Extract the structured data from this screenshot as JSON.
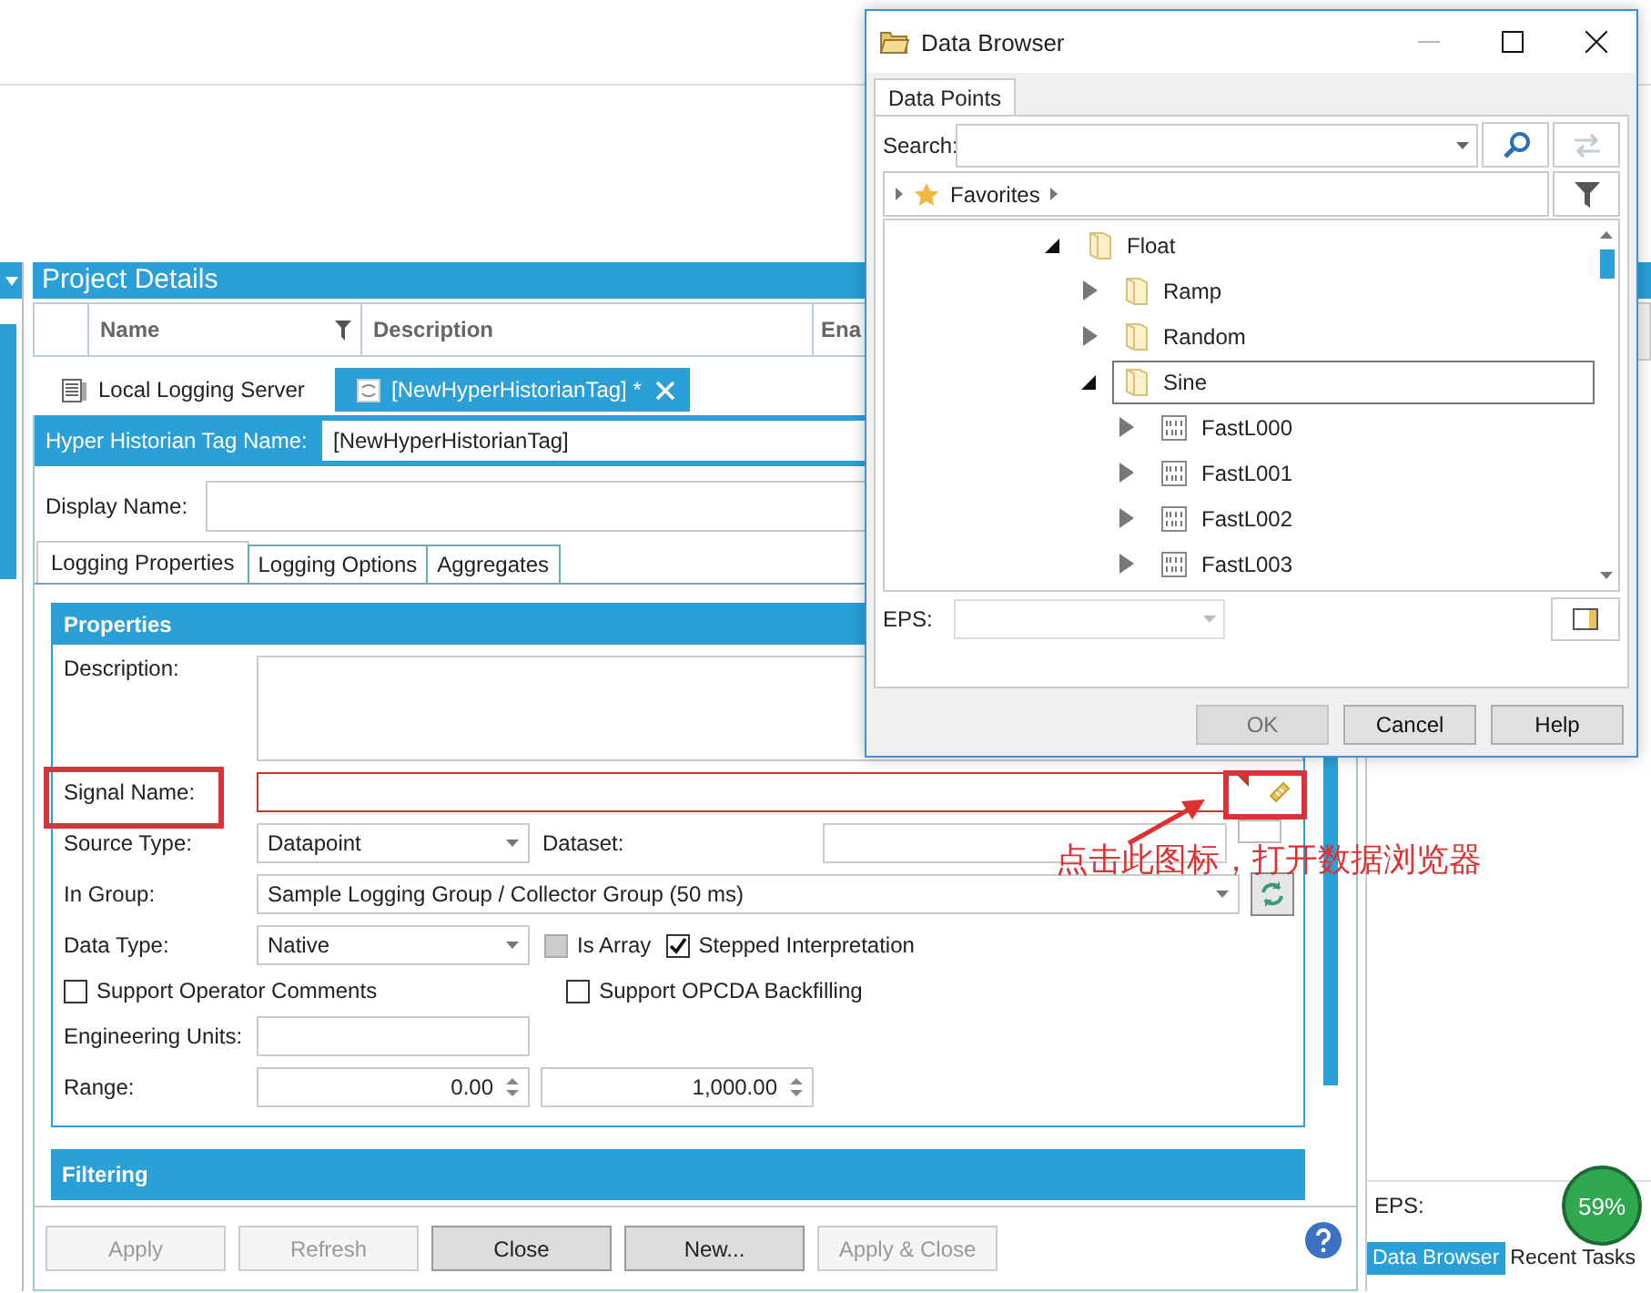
{
  "project_details": {
    "title": "Project Details",
    "columns": [
      {
        "label": "Name",
        "filter": true
      },
      {
        "label": "Description",
        "filter": false
      },
      {
        "label": "Ena",
        "filter": false
      }
    ]
  },
  "document_tabs": [
    {
      "label": "Local Logging Server",
      "kind": "server",
      "selected": false
    },
    {
      "label": "[NewHyperHistorianTag] *",
      "kind": "tag",
      "selected": true
    }
  ],
  "tag_name": {
    "label": "Hyper Historian Tag Name:",
    "value": "[NewHyperHistorianTag]"
  },
  "display_name": {
    "label": "Display Name:"
  },
  "property_tabs": [
    {
      "label": "Logging Properties",
      "selected": true
    },
    {
      "label": "Logging Options",
      "selected": false
    },
    {
      "label": "Aggregates",
      "selected": false
    }
  ],
  "properties": {
    "title": "Properties",
    "description_label": "Description:",
    "signal_name": {
      "label": "Signal Name:",
      "error": true
    },
    "source_type": {
      "label": "Source Type:",
      "value": "Datapoint"
    },
    "dataset": {
      "label": "Dataset:"
    },
    "in_group": {
      "label": "In Group:",
      "value": "Sample Logging Group / Collector Group (50 ms)"
    },
    "data_type": {
      "label": "Data Type:",
      "value": "Native"
    },
    "checkboxes": [
      {
        "label": "Is Array",
        "checked": false,
        "disabled": true
      },
      {
        "label": "Stepped Interpretation",
        "checked": true,
        "disabled": false
      },
      {
        "label": "Support Operator Comments",
        "checked": false,
        "disabled": false
      },
      {
        "label": "Support OPCDA Backfilling",
        "checked": false,
        "disabled": false
      }
    ],
    "engineering_units": {
      "label": "Engineering Units:"
    },
    "range": {
      "label": "Range:",
      "low": "0.00",
      "high": "1,000.00"
    }
  },
  "filtering": {
    "title": "Filtering"
  },
  "buttons": [
    {
      "label": "Apply",
      "disabled": true
    },
    {
      "label": "Refresh",
      "disabled": true
    },
    {
      "label": "Close",
      "disabled": false
    },
    {
      "label": "New...",
      "disabled": false
    },
    {
      "label": "Apply & Close",
      "disabled": true
    }
  ],
  "right_panel": {
    "eps_label": "EPS:",
    "tabs": [
      {
        "label": "Data Browser",
        "selected": true
      },
      {
        "label": "Recent Tasks",
        "selected": false
      }
    ]
  },
  "progress_badge": {
    "text": "59%"
  },
  "annotation": {
    "text": "点击此图标，打开数据浏览器"
  },
  "dialog": {
    "title": "Data Browser",
    "tabs": [
      {
        "label": "Data Points",
        "selected": true
      }
    ],
    "search": {
      "label": "Search:"
    },
    "breadcrumb": {
      "label": "Favorites"
    },
    "tree": [
      {
        "label": "Float",
        "kind": "folder",
        "expanded": true,
        "selected": false,
        "children": [
          {
            "label": "Ramp",
            "kind": "folder",
            "expanded": false,
            "selected": false
          },
          {
            "label": "Random",
            "kind": "folder",
            "expanded": false,
            "selected": false
          },
          {
            "label": "Sine",
            "kind": "folder",
            "expanded": true,
            "selected": true,
            "children": [
              {
                "label": "FastL000",
                "kind": "tag",
                "expanded": false,
                "selected": false
              },
              {
                "label": "FastL001",
                "kind": "tag",
                "expanded": false,
                "selected": false
              },
              {
                "label": "FastL002",
                "kind": "tag",
                "expanded": false,
                "selected": false
              },
              {
                "label": "FastL003",
                "kind": "tag",
                "expanded": false,
                "selected": false
              }
            ]
          }
        ]
      }
    ],
    "eps": {
      "label": "EPS:"
    },
    "buttons": [
      {
        "label": "OK",
        "disabled": true
      },
      {
        "label": "Cancel",
        "disabled": false
      },
      {
        "label": "Help",
        "disabled": false
      }
    ]
  }
}
